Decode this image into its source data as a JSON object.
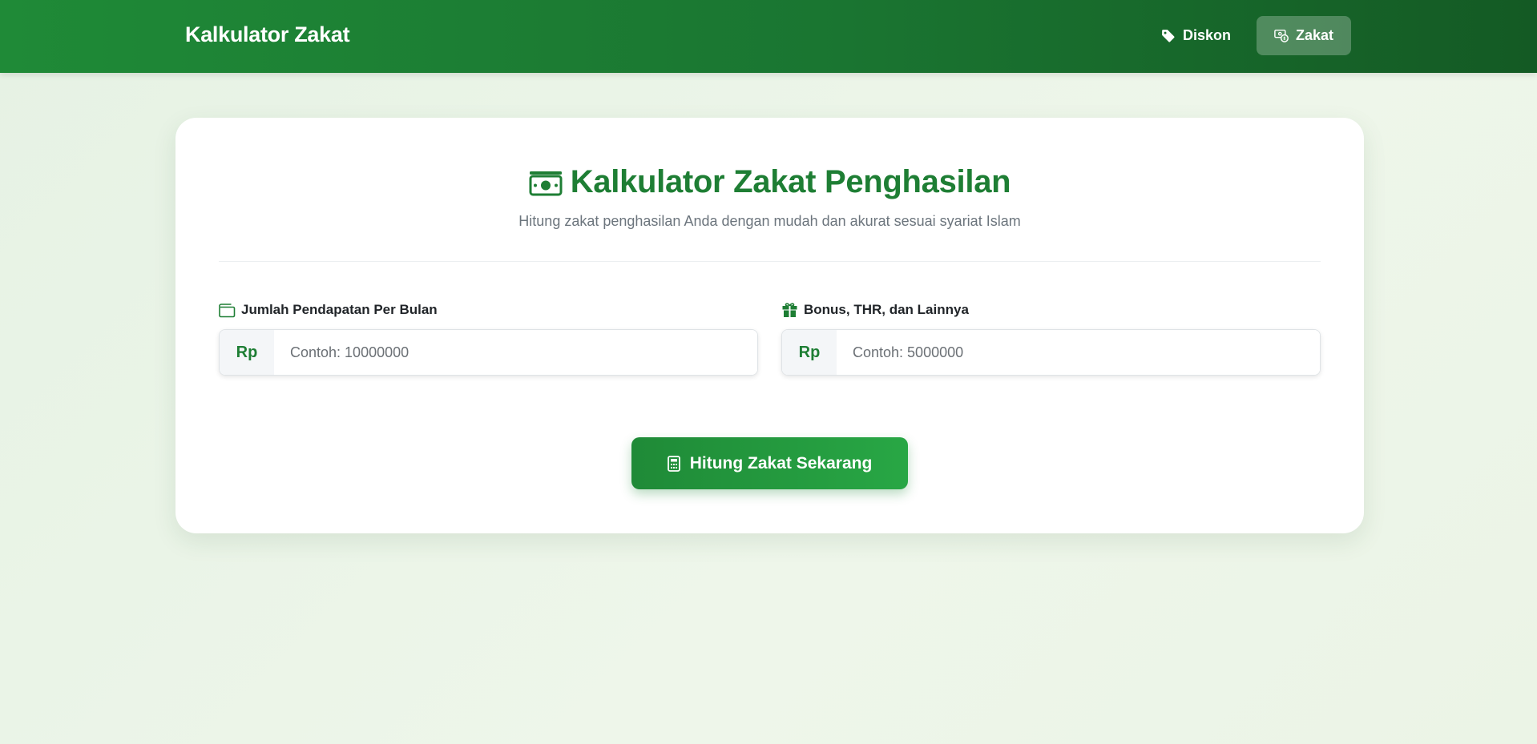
{
  "navbar": {
    "brand": "Kalkulator Zakat",
    "links": [
      {
        "label": "Diskon",
        "icon": "tag-icon",
        "active": false
      },
      {
        "label": "Zakat",
        "icon": "money-icon",
        "active": true
      }
    ]
  },
  "calculator": {
    "title": "Kalkulator Zakat Penghasilan",
    "title_icon": "money-bill-icon",
    "subtitle": "Hitung zakat penghasilan Anda dengan mudah dan akurat sesuai syariat Islam",
    "fields": [
      {
        "label": "Jumlah Pendapatan Per Bulan",
        "icon": "wallet-icon",
        "prefix": "Rp",
        "value": "",
        "placeholder": "Contoh: 10000000"
      },
      {
        "label": "Bonus, THR, dan Lainnya",
        "icon": "gift-icon",
        "prefix": "Rp",
        "value": "",
        "placeholder": "Contoh: 5000000"
      }
    ],
    "submit_label": "Hitung Zakat Sekarang",
    "submit_icon": "calculator-icon"
  },
  "colors": {
    "primary": "#1e7e34",
    "primary_light": "#28a745",
    "background": "#e9f3e6"
  }
}
